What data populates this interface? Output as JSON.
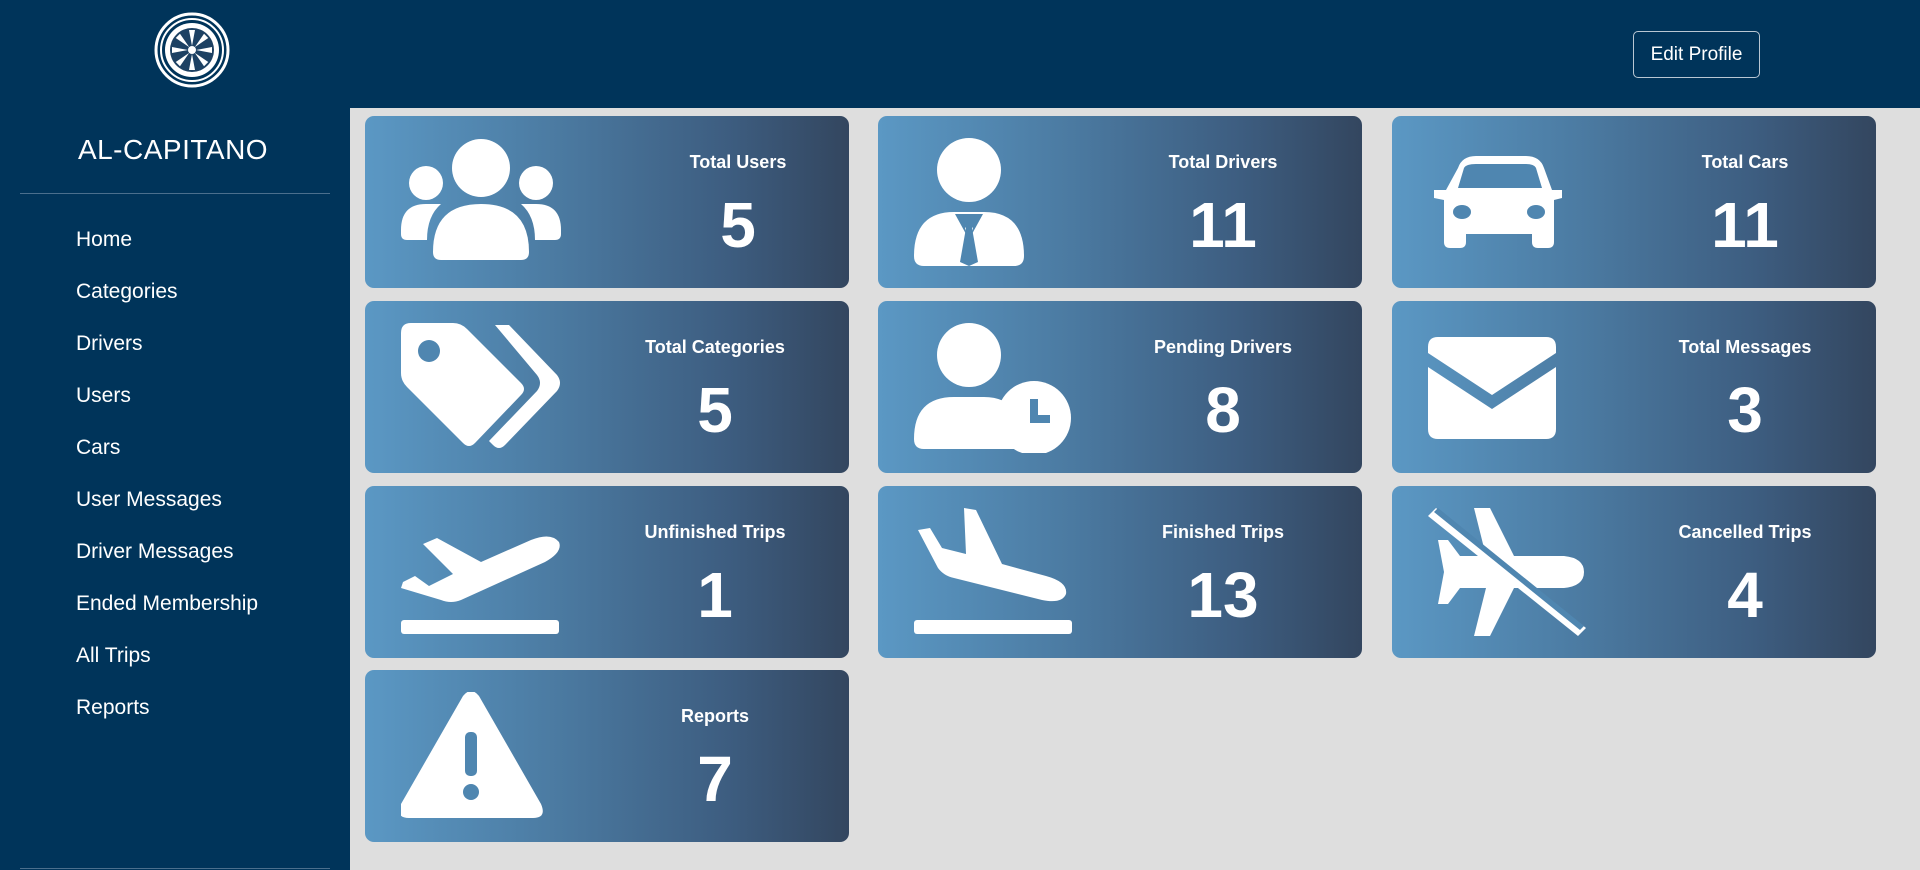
{
  "sidebar": {
    "brand": "AL-CAPITANO",
    "logo_icon": "wheel-icon",
    "nav": [
      "Home",
      "Categories",
      "Drivers",
      "Users",
      "Cars",
      "User Messages",
      "Driver Messages",
      "Ended Membership",
      "All Trips",
      "Reports"
    ]
  },
  "header": {
    "edit_profile_label": "Edit Profile"
  },
  "colors": {
    "sidebar": "#00345a",
    "background": "#dedede",
    "card_gradient_start": "#5b98c4",
    "card_gradient_end": "#33465f"
  },
  "cards": [
    {
      "title": "Total Users",
      "value": "5",
      "icon": "users-icon"
    },
    {
      "title": "Total Drivers",
      "value": "11",
      "icon": "driver-icon"
    },
    {
      "title": "Total Cars",
      "value": "11",
      "icon": "car-icon"
    },
    {
      "title": "Total Categories",
      "value": "5",
      "icon": "tags-icon"
    },
    {
      "title": "Pending Drivers",
      "value": "8",
      "icon": "user-clock-icon"
    },
    {
      "title": "Total Messages",
      "value": "3",
      "icon": "envelope-icon"
    },
    {
      "title": "Unfinished Trips",
      "value": "1",
      "icon": "plane-departure-icon"
    },
    {
      "title": "Finished Trips",
      "value": "13",
      "icon": "plane-arrival-icon"
    },
    {
      "title": "Cancelled Trips",
      "value": "4",
      "icon": "plane-slash-icon"
    },
    {
      "title": "Reports",
      "value": "7",
      "icon": "warning-icon"
    }
  ]
}
